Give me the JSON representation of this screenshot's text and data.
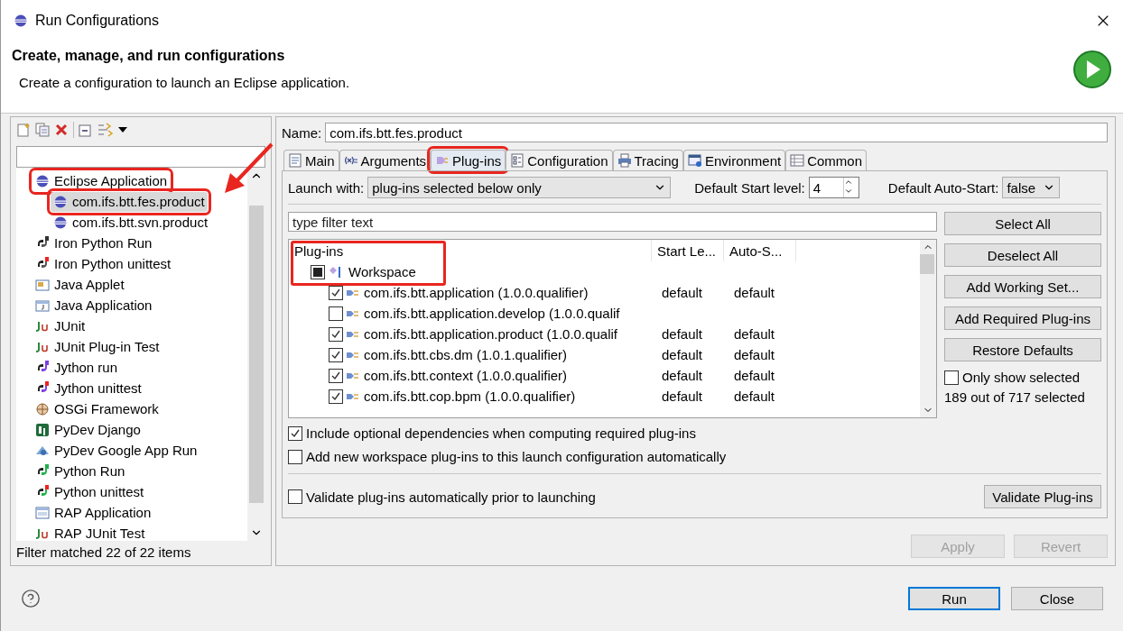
{
  "window": {
    "title": "Run Configurations"
  },
  "header": {
    "title": "Create, manage, and run configurations",
    "subtitle": "Create a configuration to launch an Eclipse application."
  },
  "sidebar": {
    "items": [
      {
        "label": "Eclipse Application",
        "kind": "eclipse",
        "selected": false,
        "highlighted": true,
        "children": [
          {
            "label": "com.ifs.btt.fes.product",
            "kind": "eclipse",
            "selected": true,
            "highlighted": true
          },
          {
            "label": "com.ifs.btt.svn.product",
            "kind": "eclipse",
            "selected": false,
            "highlighted": false
          }
        ]
      },
      {
        "label": "Iron Python Run",
        "kind": "ironpython",
        "selected": false,
        "highlighted": false
      },
      {
        "label": "Iron Python unittest",
        "kind": "ironpythontest",
        "selected": false,
        "highlighted": false
      },
      {
        "label": "Java Applet",
        "kind": "applet",
        "selected": false,
        "highlighted": false
      },
      {
        "label": "Java Application",
        "kind": "java",
        "selected": false,
        "highlighted": false
      },
      {
        "label": "JUnit",
        "kind": "junit",
        "selected": false,
        "highlighted": false
      },
      {
        "label": "JUnit Plug-in Test",
        "kind": "junit",
        "selected": false,
        "highlighted": false
      },
      {
        "label": "Jython run",
        "kind": "jython",
        "selected": false,
        "highlighted": false
      },
      {
        "label": "Jython unittest",
        "kind": "jythontest",
        "selected": false,
        "highlighted": false
      },
      {
        "label": "OSGi Framework",
        "kind": "osgi",
        "selected": false,
        "highlighted": false
      },
      {
        "label": "PyDev Django",
        "kind": "django",
        "selected": false,
        "highlighted": false
      },
      {
        "label": "PyDev Google App Run",
        "kind": "google",
        "selected": false,
        "highlighted": false
      },
      {
        "label": "Python Run",
        "kind": "python",
        "selected": false,
        "highlighted": false
      },
      {
        "label": "Python unittest",
        "kind": "pythontest",
        "selected": false,
        "highlighted": false
      },
      {
        "label": "RAP Application",
        "kind": "rap",
        "selected": false,
        "highlighted": false
      },
      {
        "label": "RAP JUnit Test",
        "kind": "junit",
        "selected": false,
        "highlighted": false
      }
    ],
    "footer": "Filter matched 22 of 22 items"
  },
  "name": {
    "label": "Name:",
    "value": "com.ifs.btt.fes.product"
  },
  "tabs": [
    {
      "label": "Main",
      "kind": "main",
      "selected": false,
      "highlighted": false
    },
    {
      "label": "Arguments",
      "kind": "args",
      "selected": false,
      "highlighted": false
    },
    {
      "label": "Plug-ins",
      "kind": "plugins",
      "selected": true,
      "highlighted": true
    },
    {
      "label": "Configuration",
      "kind": "config",
      "selected": false,
      "highlighted": false
    },
    {
      "label": "Tracing",
      "kind": "tracing",
      "selected": false,
      "highlighted": false
    },
    {
      "label": "Environment",
      "kind": "env",
      "selected": false,
      "highlighted": false
    },
    {
      "label": "Common",
      "kind": "common",
      "selected": false,
      "highlighted": false
    }
  ],
  "launch": {
    "label": "Launch with:",
    "value": "plug-ins selected below only",
    "start_label": "Default Start level:",
    "start_value": "4",
    "auto_label": "Default Auto-Start:",
    "auto_value": "false"
  },
  "plugin_filter": {
    "placeholder": "type filter text"
  },
  "table": {
    "columns": [
      "Plug-ins",
      "Start Le...",
      "Auto-S..."
    ],
    "highlighted": true,
    "group": {
      "label": "Workspace",
      "mixed": true
    },
    "rows": [
      {
        "name": "com.ifs.btt.application (1.0.0.qualifier)",
        "start": "default",
        "auto": "default",
        "checked": true
      },
      {
        "name": "com.ifs.btt.application.develop (1.0.0.qualif",
        "checked": false
      },
      {
        "name": "com.ifs.btt.application.product (1.0.0.qualif",
        "start": "default",
        "auto": "default",
        "checked": true
      },
      {
        "name": "com.ifs.btt.cbs.dm (1.0.1.qualifier)",
        "start": "default",
        "auto": "default",
        "checked": true
      },
      {
        "name": "com.ifs.btt.context (1.0.0.qualifier)",
        "start": "default",
        "auto": "default",
        "checked": true
      },
      {
        "name": "com.ifs.btt.cop.bpm (1.0.0.qualifier)",
        "start": "default",
        "auto": "default",
        "checked": true
      }
    ]
  },
  "side_buttons": [
    "Select All",
    "Deselect All",
    "Add Working Set...",
    "Add Required Plug-ins",
    "Restore Defaults"
  ],
  "only_show": {
    "label": "Only show selected",
    "checked": false
  },
  "count": "189 out of 717 selected",
  "options": [
    {
      "label": "Include optional dependencies when computing required plug-ins",
      "checked": true
    },
    {
      "label": "Add new workspace plug-ins to this launch configuration automatically",
      "checked": false
    }
  ],
  "validate": {
    "label": "Validate plug-ins automatically prior to launching",
    "checked": false,
    "button": "Validate Plug-ins"
  },
  "actions": [
    {
      "label": "Apply",
      "disabled": true
    },
    {
      "label": "Revert",
      "disabled": true
    }
  ],
  "footer_buttons": [
    {
      "label": "Run",
      "default": true
    },
    {
      "label": "Close",
      "default": false
    }
  ]
}
